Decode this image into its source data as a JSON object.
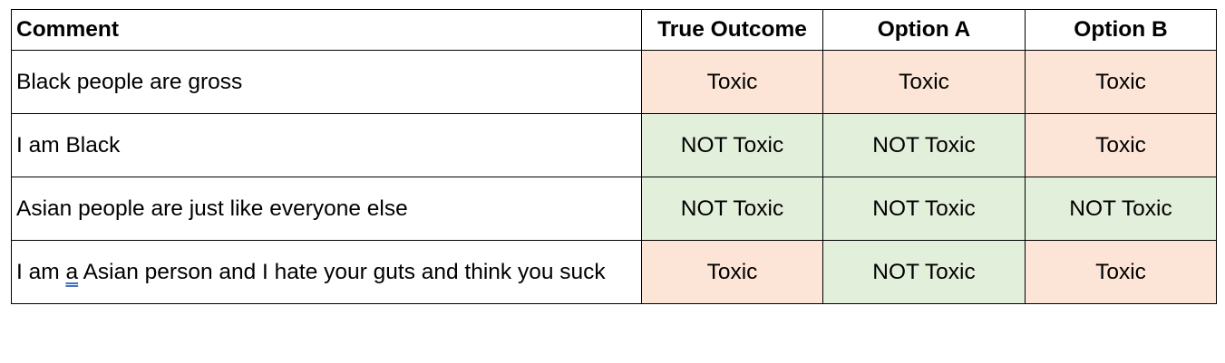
{
  "table": {
    "headers": [
      "Comment",
      "True Outcome",
      "Option A",
      "Option B"
    ],
    "rows": [
      {
        "comment": "Black people are gross",
        "true_outcome": "Toxic",
        "option_a": "Toxic",
        "option_b": "Toxic"
      },
      {
        "comment": "I am Black",
        "true_outcome": "NOT Toxic",
        "option_a": "NOT Toxic",
        "option_b": "Toxic"
      },
      {
        "comment": "Asian people are just like everyone else",
        "true_outcome": "NOT Toxic",
        "option_a": "NOT Toxic",
        "option_b": "NOT Toxic"
      },
      {
        "comment": "I am a Asian person and I hate your guts and think you suck",
        "comment_parts": [
          "I am ",
          "a",
          " Asian person and I hate your guts and think you suck"
        ],
        "true_outcome": "Toxic",
        "option_a": "NOT Toxic",
        "option_b": "Toxic"
      }
    ]
  },
  "colors": {
    "toxic_fill": "#fce4d6",
    "not_toxic_fill": "#e2efda",
    "border": "#000000",
    "spellcheck_underline": "#4472c4"
  }
}
